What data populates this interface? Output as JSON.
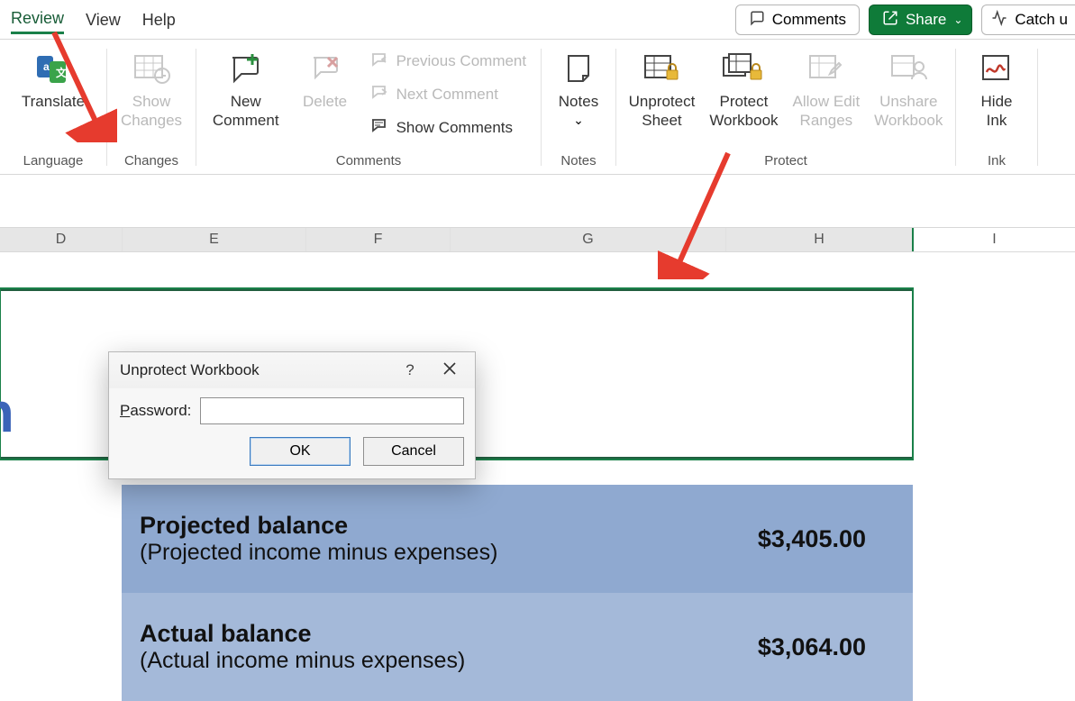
{
  "tabs": {
    "review": "Review",
    "view": "View",
    "help": "Help"
  },
  "topbuttons": {
    "comments": "Comments",
    "share": "Share",
    "catchup": "Catch u"
  },
  "ribbon": {
    "language": {
      "label": "Language",
      "translate": "Translate"
    },
    "changes": {
      "label": "Changes",
      "show_changes": "Show\nChanges"
    },
    "comments": {
      "label": "Comments",
      "new_comment": "New\nComment",
      "delete": "Delete",
      "previous": "Previous Comment",
      "next": "Next Comment",
      "show": "Show Comments"
    },
    "notes": {
      "label": "Notes",
      "notes": "Notes"
    },
    "protect": {
      "label": "Protect",
      "unprotect_sheet": "Unprotect\nSheet",
      "protect_workbook": "Protect\nWorkbook",
      "allow_edit": "Allow Edit\nRanges",
      "unshare": "Unshare\nWorkbook"
    },
    "ink": {
      "label": "Ink",
      "hide_ink": "Hide\nInk"
    }
  },
  "columns": [
    "D",
    "E",
    "F",
    "G",
    "H",
    "I"
  ],
  "sheet": {
    "title_fragment": "onth",
    "rows": [
      {
        "title": "Projected balance",
        "sub": "(Projected income minus expenses)",
        "amount": "$3,405.00"
      },
      {
        "title": "Actual balance",
        "sub": "(Actual income minus expenses)",
        "amount": "$3,064.00"
      }
    ]
  },
  "dialog": {
    "title": "Unprotect Workbook",
    "password_label": "Password:",
    "ok": "OK",
    "cancel": "Cancel"
  }
}
